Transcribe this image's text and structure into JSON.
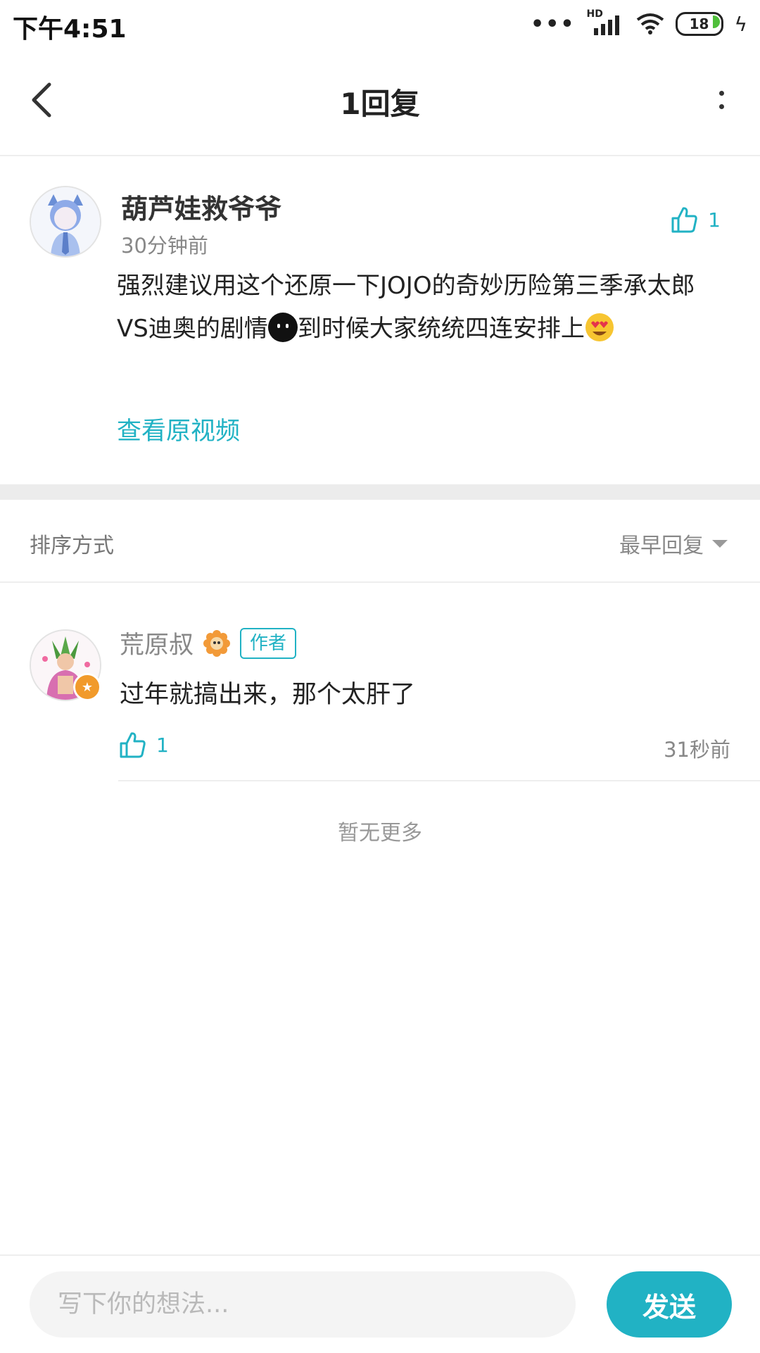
{
  "status_bar": {
    "time": "下午4:51",
    "network": "HD",
    "battery": "18"
  },
  "header": {
    "title": "1回复"
  },
  "comment": {
    "author": "葫芦娃救爷爷",
    "time": "30分钟前",
    "likes": "1",
    "text_part1": "强烈建议用这个还原一下JOJO的奇妙历险第三季承太郎VS迪奥的剧情",
    "text_part2": "到时候大家统统四连安排上",
    "view_video": "查看原视频"
  },
  "sort": {
    "label": "排序方式",
    "value": "最早回复"
  },
  "reply": {
    "author": "荒原叔",
    "tag": "作者",
    "text": "过年就搞出来，那个太肝了",
    "likes": "1",
    "time": "31秒前"
  },
  "footer_text": "暂无更多",
  "input": {
    "placeholder": "写下你的想法...",
    "send_label": "发送"
  },
  "colors": {
    "accent": "#21b2c4",
    "badge": "#f19a2b"
  }
}
